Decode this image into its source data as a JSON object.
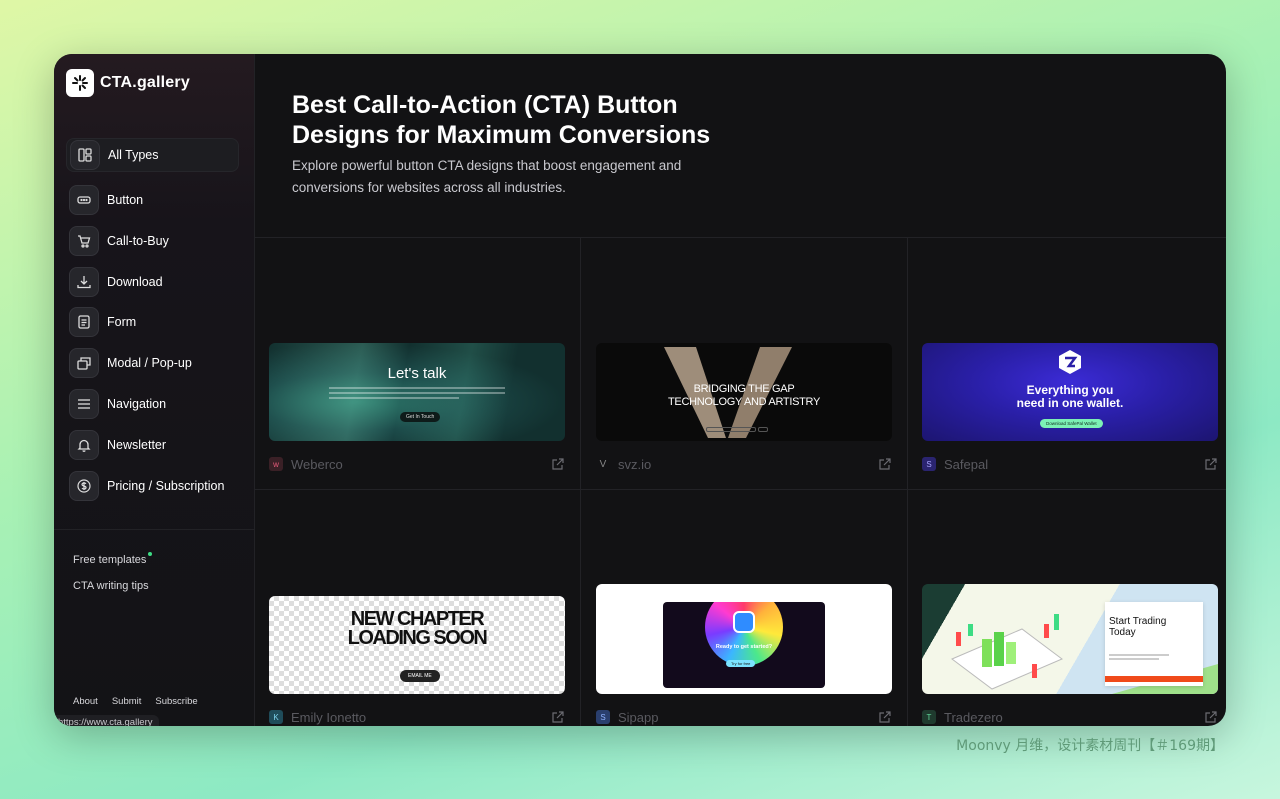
{
  "app": {
    "name": "CTA.gallery"
  },
  "sidebar": {
    "items": [
      {
        "label": "All Types",
        "icon": "layout-grid-icon",
        "active": true
      },
      {
        "label": "Button",
        "icon": "button-icon"
      },
      {
        "label": "Call-to-Buy",
        "icon": "cart-icon"
      },
      {
        "label": "Download",
        "icon": "download-icon"
      },
      {
        "label": "Form",
        "icon": "form-icon"
      },
      {
        "label": "Modal / Pop-up",
        "icon": "modal-icon"
      },
      {
        "label": "Navigation",
        "icon": "menu-icon"
      },
      {
        "label": "Newsletter",
        "icon": "bell-icon"
      },
      {
        "label": "Pricing / Subscription",
        "icon": "dollar-icon"
      }
    ],
    "links": [
      {
        "label": "Free templates",
        "new_dot": true
      },
      {
        "label": "CTA writing tips"
      }
    ],
    "footer": [
      "About",
      "Submit",
      "Subscribe"
    ],
    "status_url": "https://www.cta.gallery"
  },
  "hero": {
    "title": "Best Call-to-Action (CTA) Button Designs for Maximum Conversions",
    "subtitle": "Explore powerful button CTA designs that boost engagement and conversions for websites across all industries."
  },
  "cards": [
    {
      "name": "Weberco",
      "thumb_heading": "Let's talk",
      "thumb_button": "Get In Touch"
    },
    {
      "name": "svz.io",
      "thumb_heading": "BRIDGING THE GAP TECHNOLOGY AND ARTISTRY",
      "thumb_word_left": "between",
      "thumb_word_right": "between"
    },
    {
      "name": "Safepal",
      "thumb_heading": "Everything you need in one wallet.",
      "thumb_button": "Download SafePal Wallet"
    },
    {
      "name": "Emily Ionetto",
      "thumb_heading": "NEW CHAPTER LOADING SOON",
      "thumb_button": "EMAIL ME"
    },
    {
      "name": "Sipapp",
      "thumb_heading": "Ready to get started?",
      "thumb_button": "Try for free"
    },
    {
      "name": "Tradezero",
      "thumb_heading": "Start Trading Today"
    }
  ],
  "watermark": "Moonvy 月维，设计素材周刊【＃169期】",
  "colors": {
    "accent_green": "#3ddc84",
    "window_bg": "#121214"
  }
}
